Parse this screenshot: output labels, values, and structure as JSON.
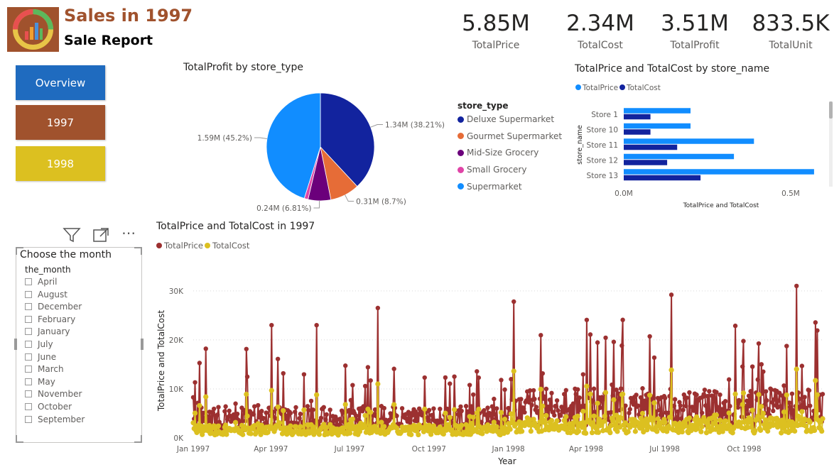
{
  "header": {
    "title": "Sales in 1997",
    "subtitle": "Sale Report"
  },
  "nav": {
    "overview": "Overview",
    "y1997": "1997",
    "y1998": "1998",
    "colors": {
      "overview": "#1f6bbf",
      "y1997": "#a0522d",
      "y1998": "#dcc020"
    }
  },
  "kpis": [
    {
      "value": "5.85M",
      "label": "TotalPrice"
    },
    {
      "value": "2.34M",
      "label": "TotalCost"
    },
    {
      "value": "3.51M",
      "label": "TotalProfit"
    },
    {
      "value": "833.5K",
      "label": "TotalUnit"
    }
  ],
  "pie_visual": {
    "title": "TotalProfit by store_type",
    "legend_title": "store_type"
  },
  "bar_visual": {
    "title": "TotalPrice and TotalCost by store_name"
  },
  "line_visual": {
    "title": "TotalPrice and TotalCost in 1997"
  },
  "slicer": {
    "title": "Choose the month",
    "field": "the_month",
    "items": [
      "April",
      "August",
      "December",
      "February",
      "January",
      "July",
      "June",
      "March",
      "May",
      "November",
      "October",
      "September"
    ]
  },
  "chart_data": [
    {
      "type": "pie",
      "title": "TotalProfit by store_type",
      "legend_title": "store_type",
      "slices": [
        {
          "name": "Deluxe Supermarket",
          "value": 1.34,
          "label": "1.34M (38.21%)",
          "color": "#12239e"
        },
        {
          "name": "Gourmet Supermarket",
          "value": 0.31,
          "label": "0.31M (8.7%)",
          "color": "#e66c37"
        },
        {
          "name": "Mid-Size Grocery",
          "value": 0.24,
          "label": "0.24M (6.81%)",
          "color": "#6b007b"
        },
        {
          "name": "Small Grocery",
          "value": 0.04,
          "label": "",
          "color": "#e044a7"
        },
        {
          "name": "Supermarket",
          "value": 1.59,
          "label": "1.59M (45.2%)",
          "color": "#118dff"
        }
      ]
    },
    {
      "type": "bar",
      "orientation": "horizontal",
      "title": "TotalPrice and TotalCost by store_name",
      "ylabel": "store_name",
      "xlabel": "TotalPrice and TotalCost",
      "categories": [
        "Store 1",
        "Store 10",
        "Store 11",
        "Store 12",
        "Store 13"
      ],
      "series": [
        {
          "name": "TotalPrice",
          "color": "#118dff",
          "values": [
            0.2,
            0.2,
            0.39,
            0.33,
            0.57
          ]
        },
        {
          "name": "TotalCost",
          "color": "#12239e",
          "values": [
            0.08,
            0.08,
            0.16,
            0.13,
            0.23
          ]
        }
      ],
      "xticks": [
        {
          "v": 0,
          "label": "0.0M"
        },
        {
          "v": 0.5,
          "label": "0.5M"
        }
      ],
      "xlim": [
        0,
        0.6
      ]
    },
    {
      "type": "line",
      "title": "TotalPrice and TotalCost in 1997",
      "xlabel": "Year",
      "ylabel": "TotalPrice and TotalCost",
      "x_start": "1997-01-01",
      "x_end": "1998-12-31",
      "x_ticks": [
        "Jan 1997",
        "Apr 1997",
        "Jul 1997",
        "Oct 1997",
        "Jan 1998",
        "Apr 1998",
        "Jul 1998",
        "Oct 1998"
      ],
      "y_ticks": [
        {
          "v": 0,
          "label": "0K"
        },
        {
          "v": 10000,
          "label": "10K"
        },
        {
          "v": 20000,
          "label": "20K"
        },
        {
          "v": 30000,
          "label": "30K"
        }
      ],
      "ylim": [
        0,
        32000
      ],
      "series": [
        {
          "name": "TotalPrice",
          "color": "#9c3030"
        },
        {
          "name": "TotalCost",
          "color": "#dcc020"
        }
      ],
      "daily_points": 700,
      "notable_peaks": [
        {
          "date": "1997-01-16",
          "TotalPrice": 18200
        },
        {
          "date": "1997-04-02",
          "TotalPrice": 23000
        },
        {
          "date": "1997-05-24",
          "TotalPrice": 23000
        },
        {
          "date": "1997-08-03",
          "TotalPrice": 26500
        },
        {
          "date": "1998-01-07",
          "TotalPrice": 27800
        },
        {
          "date": "1998-07-09",
          "TotalPrice": 29200
        },
        {
          "date": "1998-12-01",
          "TotalPrice": 31000
        }
      ]
    }
  ]
}
